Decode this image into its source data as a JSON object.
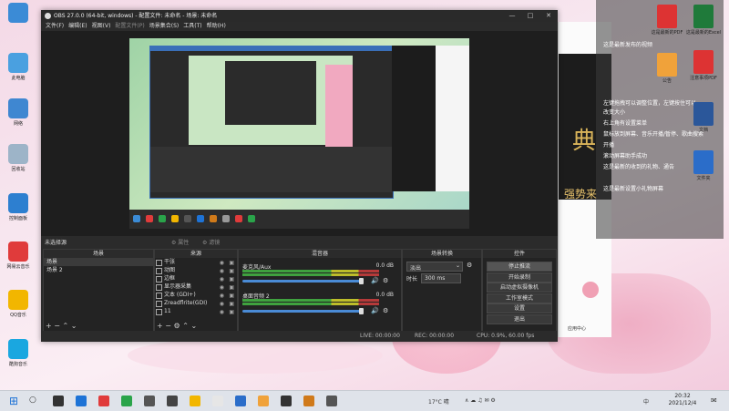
{
  "desktop": {
    "left_icons": [
      {
        "label": "",
        "color": "#3b8bd6"
      },
      {
        "label": "此电脑",
        "color": "#4aa0e0"
      },
      {
        "label": "网络",
        "color": "#3f87d1"
      },
      {
        "label": "回收站",
        "color": "#9db4c8"
      },
      {
        "label": "控制面板",
        "color": "#2d7fd0"
      },
      {
        "label": "网易云音乐",
        "color": "#e03b3b"
      },
      {
        "label": "QQ音乐",
        "color": "#f2b600"
      },
      {
        "label": "酷狗音乐",
        "color": "#1aa7e0"
      }
    ],
    "right_icons": [
      {
        "label": "这是最新的PDF",
        "color": "#d33"
      },
      {
        "label": "这是最新的Excel",
        "color": "#1f7a3a"
      },
      {
        "label": "公告",
        "color": "#f0a23a"
      },
      {
        "label": "注意事项PDF",
        "color": "#d33"
      },
      {
        "label": "文档",
        "color": "#2b579a"
      },
      {
        "label": "文件夹",
        "color": "#2b6dc9"
      }
    ],
    "overlay_lines": [
      "这是最新发布的视频",
      "左键拖拽可以调整位置，左键按住可以",
      "改变大小",
      "右上角有设置菜单",
      "鼠标放到屏幕、音乐开播/暂停、歌曲搜索",
      "开播",
      "滚动屏幕助手成功",
      "这是最新的收到的礼物、通告",
      "这是最新设置小礼物屏幕"
    ],
    "right_panel": {
      "headline": "典",
      "sub": "强势来",
      "app_label": "应用中心"
    }
  },
  "obs": {
    "title": "OBS 27.0.0 (64-bit, windows) - 配置文件: 未命名 - 场景: 未命名",
    "menu": [
      {
        "label": "文件(F)",
        "dim": false
      },
      {
        "label": "编辑(E)",
        "dim": false
      },
      {
        "label": "视图(V)",
        "dim": false
      },
      {
        "label": "配置文件(P)",
        "dim": true
      },
      {
        "label": "场景集合(S)",
        "dim": false
      },
      {
        "label": "工具(T)",
        "dim": false
      },
      {
        "label": "帮助(H)",
        "dim": false
      }
    ],
    "status_row": {
      "no_source": "未选择源",
      "properties": "属性",
      "filters": "滤镜"
    },
    "scenes": {
      "header": "场景",
      "items": [
        "场景",
        "场景 2"
      ]
    },
    "sources": {
      "header": "来源",
      "items": [
        "干张",
        "动图",
        "边框",
        "显示器采集",
        "文本 (GDI+)",
        "Zreadflrite(GDI)",
        "11"
      ]
    },
    "mixer": {
      "header": "混音器",
      "channels": [
        {
          "name": "麦克风/Aux",
          "db": "0.0 dB"
        },
        {
          "name": "桌面音频 2",
          "db": "0.0 dB"
        }
      ]
    },
    "transitions": {
      "header": "场景转换",
      "selected": "淡出",
      "duration_label": "时长",
      "duration_value": "300 ms"
    },
    "controls": {
      "header": "控件",
      "buttons": [
        "停止推流",
        "开始录制",
        "启动虚拟摄像机",
        "工作室模式",
        "设置",
        "退出"
      ]
    },
    "statusbar": {
      "live": "LIVE: 00:00:00",
      "rec": "REC: 00:00:00",
      "cpu": "CPU: 0.9%, 60.00 fps"
    }
  },
  "taskbar": {
    "weather": "17°C 晴",
    "ime": "中",
    "time": "20:32",
    "date": "2021/12/4",
    "app_colors": [
      "#333",
      "#1e73d6",
      "#e03b3b",
      "#2aa44a",
      "#555",
      "#444",
      "#f2b600",
      "#e6e6e6",
      "#2b6dc9",
      "#f0a23a",
      "#333",
      "#d07a1a",
      "#555"
    ]
  }
}
